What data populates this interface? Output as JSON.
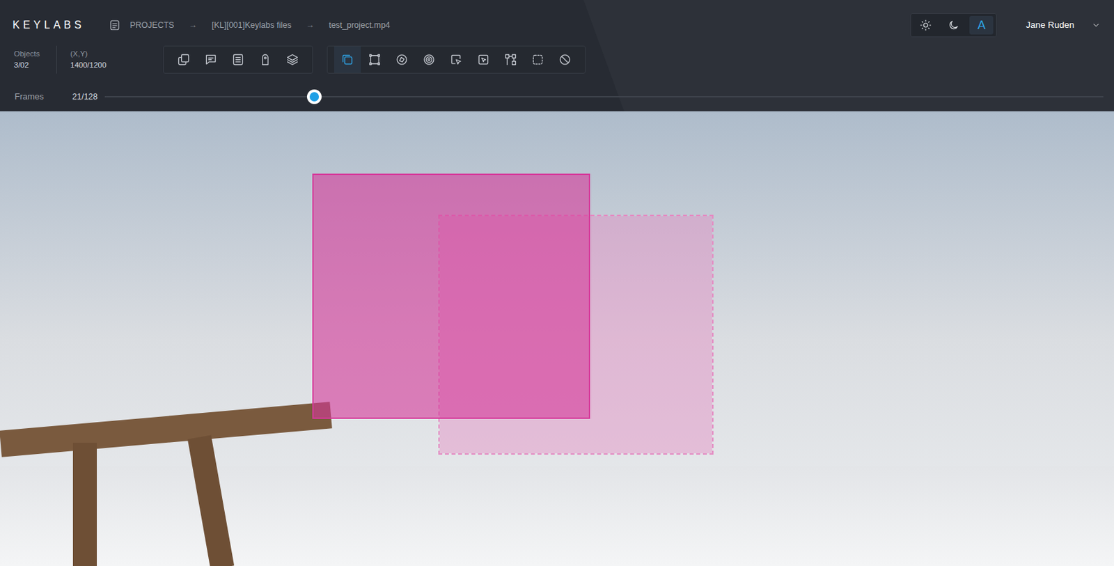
{
  "logo": "KEYLABS",
  "breadcrumb": {
    "separator": "→",
    "items": [
      {
        "label": "PROJECTS"
      },
      {
        "label": "[KL][001]Keylabs files"
      },
      {
        "label": "test_project.mp4"
      }
    ]
  },
  "theme_modes": [
    {
      "kind": "sun",
      "selected": false
    },
    {
      "kind": "moon",
      "selected": false
    },
    {
      "kind": "auto",
      "label": "A",
      "selected": true
    }
  ],
  "user": {
    "name": "Jane Ruden"
  },
  "stats": [
    {
      "label": "Objects",
      "value": "3/02"
    },
    {
      "label": "(X,Y)",
      "value": "1400/1200"
    }
  ],
  "tool_groups": [
    {
      "tools": [
        {
          "kind": "copy",
          "selected": false
        },
        {
          "kind": "comment",
          "selected": false
        },
        {
          "kind": "list",
          "selected": false
        },
        {
          "kind": "tag",
          "selected": false
        },
        {
          "kind": "layers",
          "selected": false
        }
      ]
    },
    {
      "tools": [
        {
          "kind": "bbox",
          "selected": true
        },
        {
          "kind": "points",
          "selected": false
        },
        {
          "kind": "polygon",
          "selected": false
        },
        {
          "kind": "target",
          "selected": false
        },
        {
          "kind": "pointer",
          "selected": false
        },
        {
          "kind": "select",
          "selected": false
        },
        {
          "kind": "skeleton",
          "selected": false
        },
        {
          "kind": "dashed",
          "selected": false
        },
        {
          "kind": "erase",
          "selected": false
        }
      ]
    }
  ],
  "frames": {
    "label": "Frames",
    "reading": "21/128",
    "level": 0.21
  },
  "annotations": [
    {
      "kind": "dashed",
      "color": "#e48cc3"
    },
    {
      "kind": "solid",
      "color": "#d6399a"
    }
  ]
}
